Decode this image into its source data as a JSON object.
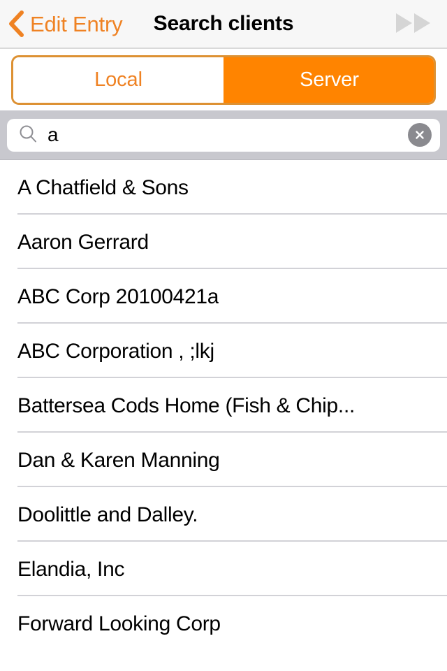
{
  "navbar": {
    "back_label": "Edit Entry",
    "back_icon": "chevron-left-icon",
    "title": "Search clients",
    "forward_icon": "fast-forward-icon"
  },
  "segmented_control": {
    "options": [
      {
        "label": "Local",
        "active": false
      },
      {
        "label": "Server",
        "active": true
      }
    ],
    "selected": "Server"
  },
  "search": {
    "icon": "search-icon",
    "value": "a",
    "placeholder": "Search",
    "clear_icon": "clear-circle-icon",
    "clear_label": "✕"
  },
  "results": {
    "items": [
      {
        "label": "A Chatfield & Sons"
      },
      {
        "label": "Aaron Gerrard"
      },
      {
        "label": "ABC Corp 20100421a"
      },
      {
        "label": "ABC Corporation , ;lkj"
      },
      {
        "label": "Battersea Cods Home (Fish & Chip..."
      },
      {
        "label": "Dan & Karen Manning"
      },
      {
        "label": "Doolittle and Dalley."
      },
      {
        "label": "Elandia, Inc"
      },
      {
        "label": "Forward Looking Corp"
      }
    ]
  },
  "colors": {
    "accent_orange": "#FF8400",
    "accent_orange_text": "#EF8223",
    "segment_border": "#DD9133",
    "navbar_bg": "#F7F7F7",
    "searchbar_bg": "#C8C8CE",
    "separator": "#D2D2D7",
    "clear_button_gray": "#8A8A8F",
    "forward_icon_gray": "#D5D5D5"
  }
}
